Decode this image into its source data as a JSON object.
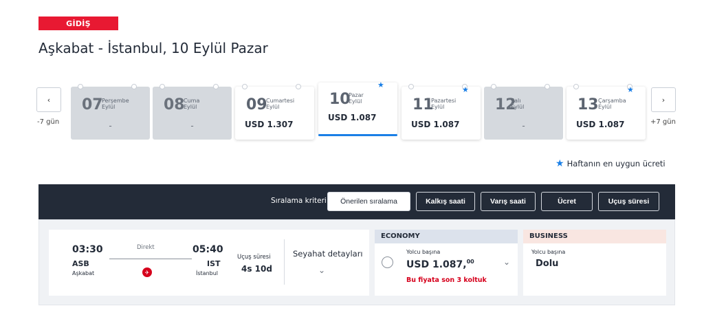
{
  "header": {
    "direction_badge": "GİDİŞ",
    "route_title": "Aşkabat - İstanbul, 10 Eylül Pazar"
  },
  "date_nav": {
    "prev_label": "-7 gün",
    "next_label": "+7 gün",
    "prev_icon": "chevron-left-icon",
    "next_icon": "chevron-right-icon",
    "days": [
      {
        "num": "07",
        "day": "Perşembe",
        "month": "Eylül",
        "price": "-",
        "available": false,
        "cheapest": false,
        "selected": false
      },
      {
        "num": "08",
        "day": "Cuma",
        "month": "Eylül",
        "price": "-",
        "available": false,
        "cheapest": false,
        "selected": false
      },
      {
        "num": "09",
        "day": "Cumartesi",
        "month": "Eylül",
        "price": "USD 1.307",
        "available": true,
        "cheapest": false,
        "selected": false
      },
      {
        "num": "10",
        "day": "Pazar",
        "month": "Eylül",
        "price": "USD 1.087",
        "available": true,
        "cheapest": true,
        "selected": true
      },
      {
        "num": "11",
        "day": "Pazartesi",
        "month": "Eylül",
        "price": "USD 1.087",
        "available": true,
        "cheapest": true,
        "selected": false
      },
      {
        "num": "12",
        "day": "Salı",
        "month": "Eylül",
        "price": "-",
        "available": false,
        "cheapest": false,
        "selected": false
      },
      {
        "num": "13",
        "day": "Çarşamba",
        "month": "Eylül",
        "price": "USD 1.087",
        "available": true,
        "cheapest": true,
        "selected": false
      }
    ]
  },
  "legend": {
    "text": "Haftanın en uygun ücreti",
    "icon": "star-icon",
    "accent": "#1a7fe6"
  },
  "sort": {
    "label": "Sıralama kriteri",
    "options": [
      "Önerilen sıralama",
      "Kalkış saati",
      "Varış saati",
      "Ücret",
      "Uçuş süresi"
    ],
    "active": "Önerilen sıralama"
  },
  "flight": {
    "dep_time": "03:30",
    "dep_code": "ASB",
    "dep_city": "Aşkabat",
    "arr_time": "05:40",
    "arr_code": "IST",
    "arr_city": "İstanbul",
    "stop_type": "Direkt",
    "airline_icon": "turkish-airlines-logo-icon",
    "duration_label": "Uçuş süresi",
    "duration": "4s 10d",
    "details_label": "Seyahat detayları"
  },
  "economy": {
    "title": "ECONOMY",
    "per_pax": "Yolcu başına",
    "price_main": "USD 1.087,",
    "price_cents": "00",
    "seats_left": "Bu fiyata son 3 koltuk",
    "warning_color": "#d6001c"
  },
  "business": {
    "title": "BUSINESS",
    "per_pax": "Yolcu başına",
    "status": "Dolu"
  },
  "colors": {
    "brand_red": "#e81932",
    "dark_bar": "#232b38",
    "accent_blue": "#1a7fe6"
  }
}
